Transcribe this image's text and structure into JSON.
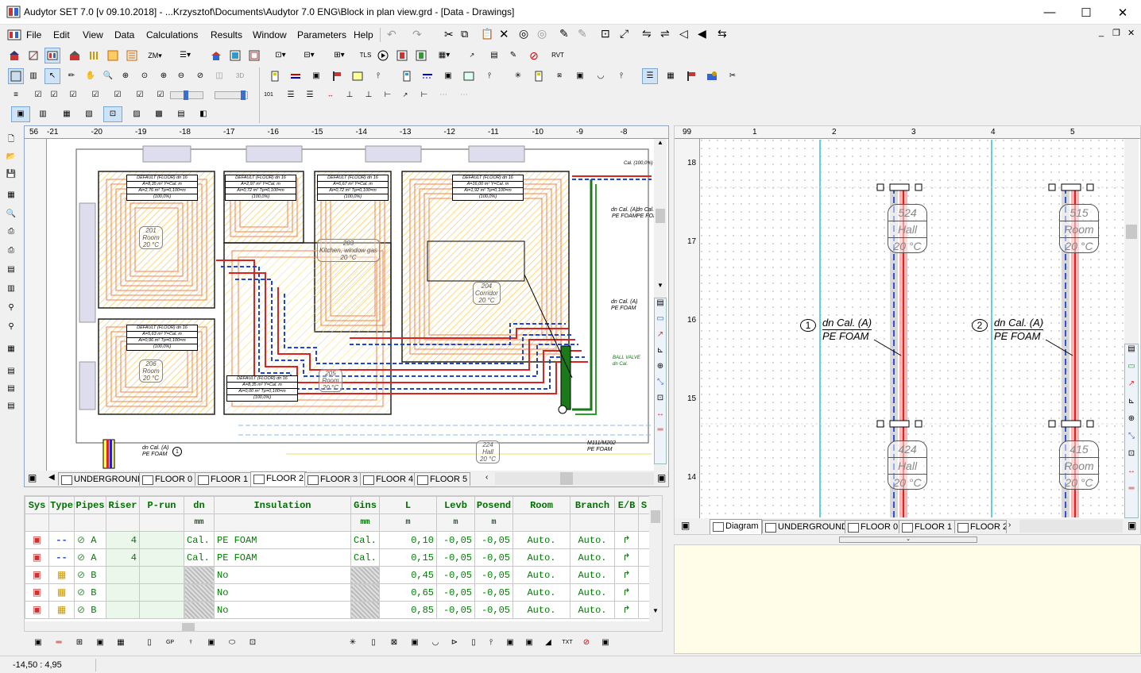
{
  "window": {
    "title": "Audytor SET 7.0  [v 09.10.2018] - ...Krzysztof\\Documents\\Audytor 7.0 ENG\\Block in plan view.grd - [Data - Drawings]",
    "minimize": "—",
    "maximize": "☐",
    "close": "✕"
  },
  "menu": [
    "File",
    "Edit",
    "View",
    "Data",
    "Calculations",
    "Results",
    "Window",
    "Parameters",
    "Help"
  ],
  "mdi": {
    "minimize": "_",
    "restore": "❐",
    "close": "✕"
  },
  "left_pane": {
    "ruler_zoom": "56",
    "ruler_ticks": [
      "-21",
      "-20",
      "-19",
      "-18",
      "-17",
      "-16",
      "-15",
      "-14",
      "-13",
      "-12",
      "-11",
      "-10",
      "-9",
      "-8"
    ],
    "tabs": [
      "UNDERGROUND",
      "FLOOR 0",
      "FLOOR 1",
      "FLOOR 2",
      "FLOOR 3",
      "FLOOR 4",
      "FLOOR 5"
    ],
    "active_tab": "FLOOR 2",
    "rooms": [
      {
        "num": "201",
        "name": "Room",
        "temp": "20 °C"
      },
      {
        "num": "203",
        "name": "Kitchen, window gas",
        "temp": "20 °C"
      },
      {
        "num": "204",
        "name": "Corridor",
        "temp": "20 °C"
      },
      {
        "num": "205",
        "name": "Room",
        "temp": "20 °C"
      },
      {
        "num": "206",
        "name": "Room",
        "temp": "20 °C"
      },
      {
        "num": "224",
        "name": "Hall",
        "temp": "20 °C"
      }
    ],
    "heating_labels": [
      {
        "title": "DEFAULT (FLOOR) dn 16",
        "l1": "A=8,35 m² Y=Cal. m",
        "l2": "Ai=2,76 m² Tp=0,100=m",
        "l3": "(100,0%)"
      },
      {
        "title": "DEFAULT (FLOOR) dn 16",
        "l1": "A=2,97 m² Y=Cal. m",
        "l2": "Ai=0,72 m² Tp=0,100=m",
        "l3": "(100,0%)"
      },
      {
        "title": "DEFAULT (FLOOR) dn 16",
        "l1": "A=6,67 m² Y=Cal. m",
        "l2": "Ai=0,72 m² Tp=0,100=m",
        "l3": "(100,0%)"
      },
      {
        "title": "DEFAULT (FLOOR) dn 16",
        "l1": "A=16,00 m² Y=Cal. m",
        "l2": "Ai=1,92 m² Tp=0,100=m",
        "l3": "(100,0%)"
      },
      {
        "title": "DEFAULT (FLOOR) dn 16",
        "l1": "A=5,63 m² Y=Cal. m",
        "l2": "Ai=0,96 m² Tp=0,100=m",
        "l3": "(100,0%)"
      },
      {
        "title": "DEFAULT (FLOOR) dn 16",
        "l1": "A=8,35 m² Y=Cal. m",
        "l2": "Ai=0,00 m² Tp=0,100=m",
        "l3": "(100,0%)"
      }
    ],
    "annotations": {
      "pipe1": "dn Cal. (A)",
      "pipe1b": "PE FOAM",
      "valve": "BALL VALVE",
      "valve_b": "dn Cal.",
      "manifold": "M111/M202",
      "manifold_b": "PE FOAM",
      "bottom": "dn Cal. (A)",
      "bottom_b": "PE FOAM",
      "cal": "Cal. (100,0%)",
      "riser_no": "1"
    }
  },
  "right_pane": {
    "ruler_zoom": "99",
    "ruler_ticks_x": [
      "1",
      "2",
      "3",
      "4",
      "5"
    ],
    "ruler_ticks_y": [
      "18",
      "17",
      "16",
      "15",
      "14"
    ],
    "tabs": [
      "Diagram",
      "UNDERGROUND",
      "FLOOR 0",
      "FLOOR 1",
      "FLOOR 2"
    ],
    "active_tab": "Diagram",
    "risers": [
      {
        "num": "1",
        "label1": "dn Cal.  (A)",
        "label2": "PE FOAM"
      },
      {
        "num": "2",
        "label1": "dn Cal.  (A)",
        "label2": "PE FOAM"
      }
    ],
    "room_tags": [
      {
        "num": "524",
        "name": "Hall",
        "temp": "20 °C"
      },
      {
        "num": "515",
        "name": "Room",
        "temp": "20 °C"
      },
      {
        "num": "424",
        "name": "Hall",
        "temp": "20 °C"
      },
      {
        "num": "415",
        "name": "Room",
        "temp": "20 °C"
      }
    ]
  },
  "table": {
    "headers": [
      "Sys",
      "Type",
      "Pipes",
      "Riser",
      "P-run",
      "dn",
      "Insulation",
      "Gins",
      "L",
      "Levb",
      "Posend",
      "Room",
      "Branch",
      "E/B",
      "S"
    ],
    "units": [
      "",
      "",
      "",
      "",
      "",
      "mm",
      "",
      "mm",
      "m",
      "m",
      "m",
      "",
      "",
      "",
      ""
    ],
    "rows": [
      {
        "pipe": "A",
        "riser": "4",
        "dn": "Cal.",
        "ins": "PE FOAM",
        "gins": "Cal.",
        "L": "0,10",
        "lev": "-0,05",
        "pos": "-0,05",
        "room": "Auto.",
        "branch": "Auto."
      },
      {
        "pipe": "A",
        "riser": "4",
        "dn": "Cal.",
        "ins": "PE FOAM",
        "gins": "Cal.",
        "L": "0,15",
        "lev": "-0,05",
        "pos": "-0,05",
        "room": "Auto.",
        "branch": "Auto."
      },
      {
        "pipe": "B",
        "riser": "",
        "dn": "",
        "ins": "No",
        "gins": "",
        "L": "0,45",
        "lev": "-0,05",
        "pos": "-0,05",
        "room": "Auto.",
        "branch": "Auto."
      },
      {
        "pipe": "B",
        "riser": "",
        "dn": "",
        "ins": "No",
        "gins": "",
        "L": "0,65",
        "lev": "-0,05",
        "pos": "-0,05",
        "room": "Auto.",
        "branch": "Auto."
      },
      {
        "pipe": "B",
        "riser": "",
        "dn": "",
        "ins": "No",
        "gins": "",
        "L": "0,85",
        "lev": "-0,05",
        "pos": "-0,05",
        "room": "Auto.",
        "branch": "Auto."
      }
    ]
  },
  "status": {
    "coords": "-14,50 : 4,95"
  }
}
